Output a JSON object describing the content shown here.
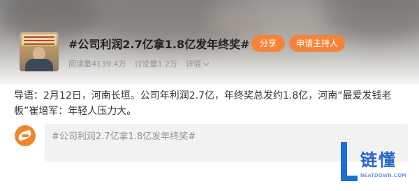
{
  "header": {
    "title": "#公司利润2.7亿拿1.8亿发年终奖#",
    "share_label": "分享",
    "host_label": "申请主持人",
    "stats": {
      "reads": "阅读量4139.4万",
      "discussions": "讨论量1.2万",
      "details": "详情"
    }
  },
  "lead_text": "导语：2月12日，河南长垣。公司年利润2.7亿，年终奖总发约1.8亿，河南“最爱发钱老板”崔培军：年轻人压力大。",
  "composer": {
    "prefill": "#公司利润2.7亿拿1.8亿发年终奖#"
  },
  "watermark": {
    "text": "链懂",
    "sub": "NEATDOWN.COM"
  },
  "colors": {
    "accent": "#f3843b",
    "watermark": "#1e6fd0"
  }
}
